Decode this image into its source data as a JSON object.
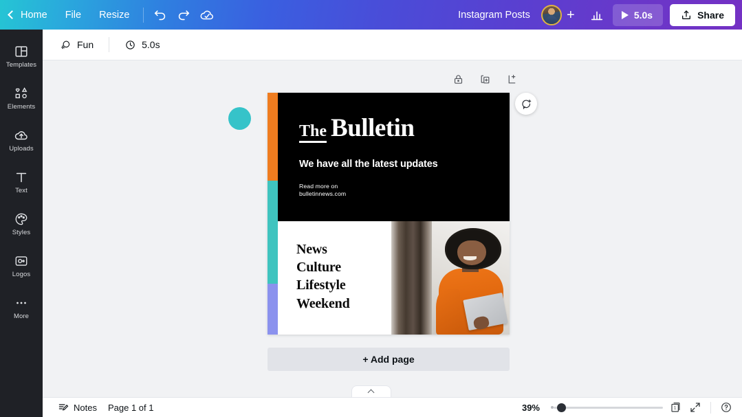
{
  "topbar": {
    "home_label": "Home",
    "file_label": "File",
    "resize_label": "Resize",
    "undo_icon": "undo-icon",
    "redo_icon": "redo-icon",
    "cloud_saved_icon": "cloud-saved-icon",
    "doc_title": "Instagram Posts",
    "avatar_icon": "avatar",
    "add_collaborator_label": "+",
    "analytics_icon": "bar-chart-icon",
    "play_duration": "5.0s",
    "play_icon": "play-icon",
    "share_label": "Share",
    "share_icon": "share-upload-icon"
  },
  "sidebar": {
    "items": [
      {
        "label": "Templates",
        "icon": "templates-icon"
      },
      {
        "label": "Elements",
        "icon": "elements-icon"
      },
      {
        "label": "Uploads",
        "icon": "uploads-cloud-icon"
      },
      {
        "label": "Text",
        "icon": "text-icon"
      },
      {
        "label": "Styles",
        "icon": "styles-palette-icon"
      },
      {
        "label": "Logos",
        "icon": "logos-icon"
      },
      {
        "label": "More",
        "icon": "more-dots-icon"
      }
    ]
  },
  "subbar": {
    "animation_label": "Fun",
    "animation_icon": "animation-icon",
    "duration_label": "5.0s",
    "duration_icon": "clock-icon"
  },
  "canvas": {
    "page_tools": [
      {
        "name": "lock-page-icon"
      },
      {
        "name": "duplicate-page-icon"
      },
      {
        "name": "add-page-icon"
      }
    ],
    "comment_icon": "add-comment-icon",
    "add_page_label": "+ Add page",
    "shape_color": "#36c3c9"
  },
  "design": {
    "stripe_colors": [
      "#ef7c1f",
      "#3fc4bf",
      "#8b92ee"
    ],
    "brand_the": "The",
    "brand_name": "Bulletin",
    "headline": "We have all the latest updates",
    "read_more_line1": "Read more on",
    "read_more_line2": "bulletinnews.com",
    "categories": [
      "News",
      "Culture",
      "Lifestyle",
      "Weekend"
    ],
    "background": "#000000",
    "photo_alt": "woman-in-orange-sweater-holding-tablet"
  },
  "bottombar": {
    "notes_label": "Notes",
    "notes_icon": "notes-icon",
    "page_indicator": "Page 1 of 1",
    "zoom_level": "39%",
    "page_count_icon": "page-1-icon",
    "page_count_label": "1",
    "fullscreen_icon": "expand-icon",
    "help_icon": "help-icon",
    "collapse_icon": "chevron-up-icon"
  }
}
